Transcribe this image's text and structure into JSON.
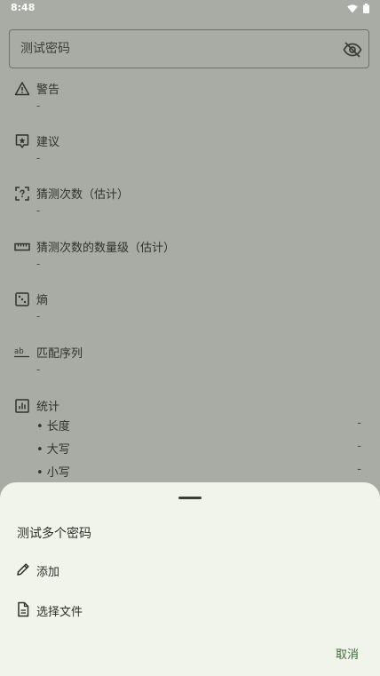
{
  "status_bar": {
    "time": "8:48",
    "icons": [
      "wifi-icon",
      "battery-icon"
    ]
  },
  "password_field": {
    "placeholder": "测试密码",
    "visibility_icon": "visibility-off-icon"
  },
  "results": [
    {
      "icon": "warning-icon",
      "title": "警告",
      "value": "-"
    },
    {
      "icon": "suggestion-icon",
      "title": "建议",
      "value": "-"
    },
    {
      "icon": "scan-icon",
      "title": "猜测次数（估计）",
      "value": "-"
    },
    {
      "icon": "ruler-icon",
      "title": "猜测次数的数量级（估计）",
      "value": "-"
    },
    {
      "icon": "dice-icon",
      "title": "熵",
      "value": "-"
    },
    {
      "icon": "spellcheck-icon",
      "title": "匹配序列",
      "value": "-"
    }
  ],
  "stats": {
    "icon": "bar-chart-icon",
    "title": "统计",
    "rows": [
      {
        "label": "• 长度",
        "value": "-"
      },
      {
        "label": "• 大写",
        "value": "-"
      },
      {
        "label": "• 小写",
        "value": "-"
      }
    ]
  },
  "bottom_sheet": {
    "title": "测试多个密码",
    "options": [
      {
        "icon": "pencil-icon",
        "label": "添加"
      },
      {
        "icon": "file-icon",
        "label": "选择文件"
      }
    ],
    "cancel_label": "取消"
  },
  "colors": {
    "scrim_background": "#a9aca4",
    "sheet_background": "#f1f4ea",
    "accent": "#3f6a3a"
  }
}
